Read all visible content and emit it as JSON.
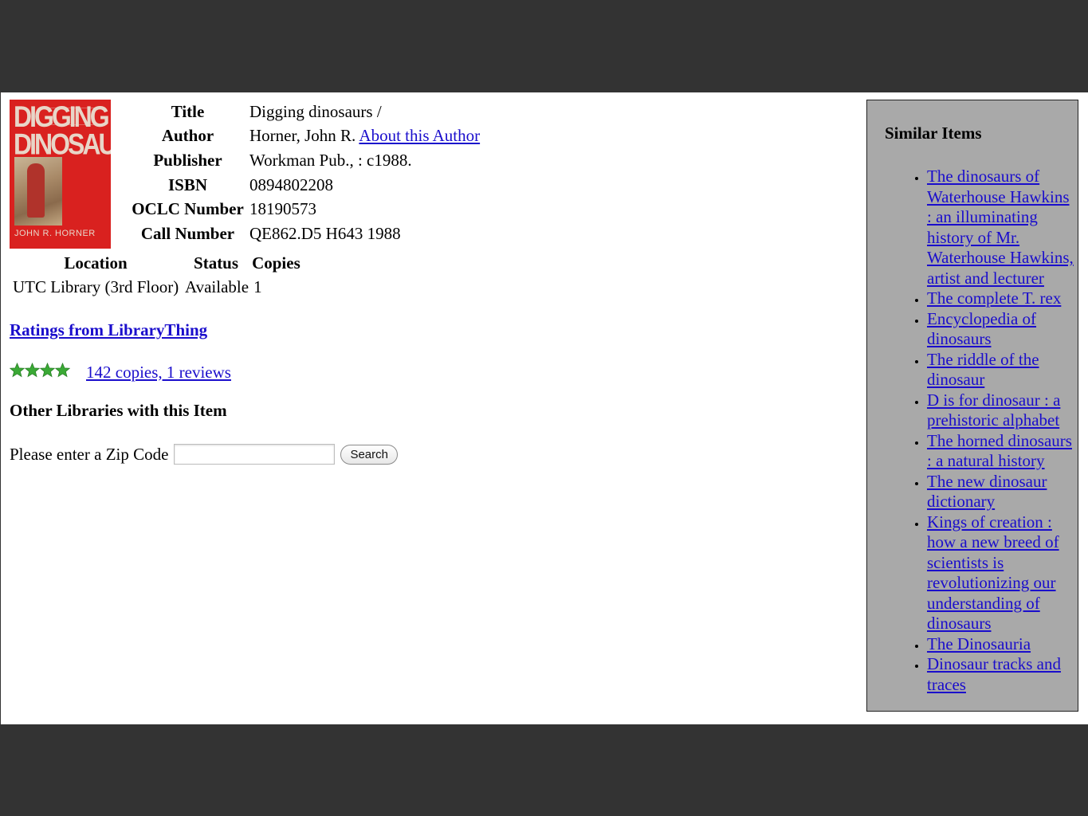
{
  "record": {
    "cover": {
      "title_text": "DIGGING DINOSAURS",
      "author_text": "JOHN R. HORNER",
      "color": "#d9211f"
    },
    "fields": [
      {
        "label": "Title",
        "value": "Digging dinosaurs /"
      },
      {
        "label": "Author",
        "value": "Horner, John R.",
        "link": "About this Author"
      },
      {
        "label": "Publisher",
        "value": "Workman Pub., : c1988."
      },
      {
        "label": "ISBN",
        "value": "0894802208"
      },
      {
        "label": "OCLC Number",
        "value": "18190573"
      },
      {
        "label": "Call Number",
        "value": "QE862.D5 H643 1988"
      }
    ]
  },
  "holdings": {
    "headers": [
      "Location",
      "Status",
      "Copies"
    ],
    "rows": [
      {
        "location": "UTC Library (3rd Floor)",
        "status": "Available",
        "copies": "1"
      }
    ]
  },
  "librarything": {
    "heading": "Ratings from LibraryThing",
    "stars": 4,
    "star_color": "#3aa935",
    "summary_link": "142 copies, 1 reviews"
  },
  "other_libraries": {
    "heading": "Other Libraries with this Item",
    "zip_label": "Please enter a Zip Code",
    "zip_value": "",
    "search_label": "Search"
  },
  "similar": {
    "heading": "Similar Items",
    "items": [
      "The dinosaurs of Waterhouse Hawkins : an illuminating history of Mr. Waterhouse Hawkins, artist and lecturer",
      "The complete T. rex",
      "Encyclopedia of dinosaurs",
      "The riddle of the dinosaur",
      "D is for dinosaur : a prehistoric alphabet",
      "The horned dinosaurs : a natural history",
      "The new dinosaur dictionary",
      "Kings of creation : how a new breed of scientists is revolutionizing our understanding of dinosaurs",
      "The Dinosauria",
      "Dinosaur tracks and traces"
    ]
  },
  "colors": {
    "link": "#1a0dcc",
    "sidebar_bg": "#a9a9a9",
    "frame_bg": "#333333"
  }
}
